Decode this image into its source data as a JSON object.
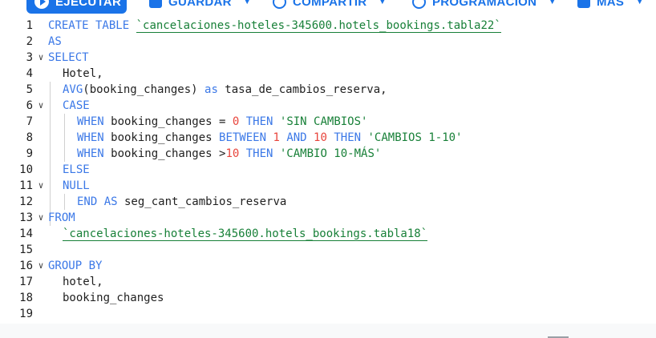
{
  "toolbar": {
    "run_label": "EJECUTAR",
    "save_label": "GUARDAR",
    "share_label": "COMPARTIR",
    "schedule_label": "PROGRAMACIÓN",
    "more_label": "MÁS"
  },
  "editor": {
    "line_numbers": [
      "1",
      "2",
      "3",
      "4",
      "5",
      "6",
      "7",
      "8",
      "9",
      "10",
      "11",
      "12",
      "13",
      "14",
      "15",
      "16",
      "17",
      "18",
      "19"
    ],
    "lines": {
      "l1_kw": "CREATE TABLE",
      "l1_tbl": "`cancelaciones-hoteles-345600.hotels_bookings.tabla22`",
      "l2_kw": "AS",
      "l3_kw": "SELECT",
      "l4": "Hotel,",
      "l5_fn": "AVG",
      "l5_mid": "(booking_changes) ",
      "l5_as": "as",
      "l5_end": " tasa_de_cambios_reserva,",
      "l6_kw": "CASE",
      "l7_when": "WHEN",
      "l7_mid": " booking_changes = ",
      "l7_num": "0",
      "l7_then": " THEN ",
      "l7_str": "'SIN CAMBIOS'",
      "l8_when": "WHEN",
      "l8_mid": " booking_changes ",
      "l8_between": "BETWEEN",
      "l8_num1": " 1",
      "l8_and": " AND",
      "l8_num2": " 10",
      "l8_then": " THEN ",
      "l8_str": "'CAMBIOS 1-10'",
      "l9_when": "WHEN",
      "l9_mid": " booking_changes >",
      "l9_num": "10",
      "l9_then": " THEN ",
      "l9_str": "'CAMBIO 10-MÁS'",
      "l10_kw": "ELSE",
      "l11_kw": "NULL",
      "l12_end": "END AS",
      "l12_rest": " seg_cant_cambios_reserva",
      "l13_kw": "FROM",
      "l14_tbl": "`cancelaciones-hoteles-345600.hotels_bookings.tabla18`",
      "l16_kw": "GROUP BY",
      "l17": "hotel,",
      "l18": "booking_changes"
    }
  },
  "colors": {
    "keyword": "#3b78e7",
    "number": "#e8453c",
    "string": "#188038",
    "accent": "#1a73e8"
  }
}
